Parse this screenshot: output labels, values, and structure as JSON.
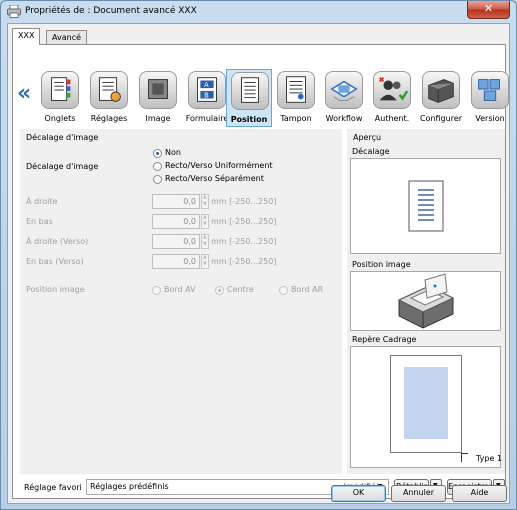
{
  "window": {
    "title": "Propriétés de : Document avancé XXX",
    "close_label": "✕"
  },
  "tabs": [
    {
      "label": "XXX"
    },
    {
      "label": "Avancé"
    }
  ],
  "ribbon": {
    "items": [
      {
        "label": "Onglets"
      },
      {
        "label": "Réglages"
      },
      {
        "label": "Image"
      },
      {
        "label": "Formulaire"
      },
      {
        "label": "Position"
      },
      {
        "label": "Tampon"
      },
      {
        "label": "Workflow"
      },
      {
        "label": "Authent."
      },
      {
        "label": "Configurer"
      },
      {
        "label": "Version"
      }
    ],
    "selected": "Position"
  },
  "settings": {
    "group_title": "Décalage d'image",
    "offset_label": "Décalage d'image",
    "options": [
      "Non",
      "Recto/Verso Uniformément",
      "Recto/Verso Séparément"
    ],
    "fields": [
      {
        "label": "À droite",
        "value": "0,0",
        "unit": "mm [-250...250]"
      },
      {
        "label": "En bas",
        "value": "0,0",
        "unit": "mm [-250...250]"
      },
      {
        "label": "À droite (Verso)",
        "value": "0,0",
        "unit": "mm [-250...250]"
      },
      {
        "label": "En bas (Verso)",
        "value": "0,0",
        "unit": "mm [-250...250]"
      }
    ],
    "position_label": "Position image",
    "position_options": [
      "Bord AV",
      "Centre",
      "Bord AR"
    ]
  },
  "preview": {
    "title": "Aperçu",
    "offset_title": "Décalage",
    "position_title": "Position image",
    "crop_title": "Repère Cadrage",
    "crop_type": "Type 1"
  },
  "footer": {
    "favorite_label": "Réglage favori",
    "favorite_value": "Réglages prédéfinis",
    "modified": "(modifié)",
    "restore": "Rétablir",
    "save": "Enregistrer"
  },
  "buttons": {
    "ok": "OK",
    "cancel": "Annuler",
    "help": "Aide"
  }
}
